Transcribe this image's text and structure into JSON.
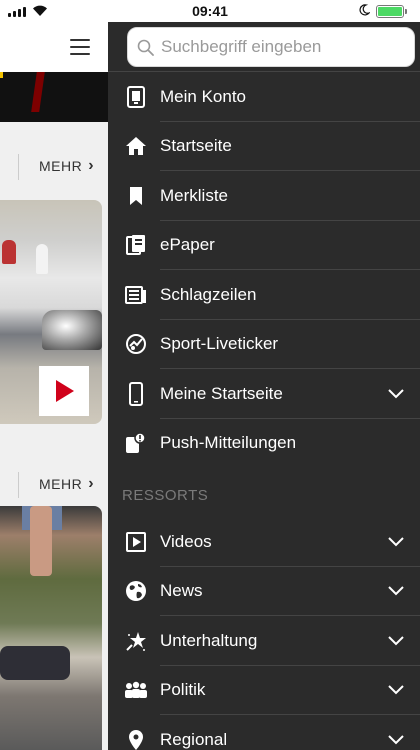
{
  "status_bar": {
    "time": "09:41"
  },
  "background": {
    "more_label": "MEHR"
  },
  "search": {
    "placeholder": "Suchbegriff eingeben"
  },
  "menu": [
    {
      "label": "Mein Konto",
      "icon": "account-icon"
    },
    {
      "label": "Startseite",
      "icon": "home-icon"
    },
    {
      "label": "Merkliste",
      "icon": "bookmark-icon"
    },
    {
      "label": "ePaper",
      "icon": "epaper-icon"
    },
    {
      "label": "Schlagzeilen",
      "icon": "headlines-icon"
    },
    {
      "label": "Sport-Liveticker",
      "icon": "sport-ticker-icon"
    },
    {
      "label": "Meine Startseite",
      "icon": "phone-icon",
      "expandable": true
    },
    {
      "label": "Push-Mitteilungen",
      "icon": "push-notification-icon"
    }
  ],
  "ressorts": {
    "heading": "RESSORTS",
    "items": [
      {
        "label": "Videos",
        "icon": "video-icon",
        "expandable": true
      },
      {
        "label": "News",
        "icon": "globe-icon",
        "expandable": true
      },
      {
        "label": "Unterhaltung",
        "icon": "star-icon",
        "expandable": true
      },
      {
        "label": "Politik",
        "icon": "people-icon",
        "expandable": true
      },
      {
        "label": "Regional",
        "icon": "location-pin-icon",
        "expandable": true
      }
    ]
  },
  "colors": {
    "drawer_bg": "#2b2b2b",
    "battery": "#4cd964",
    "play": "#d0021b"
  }
}
